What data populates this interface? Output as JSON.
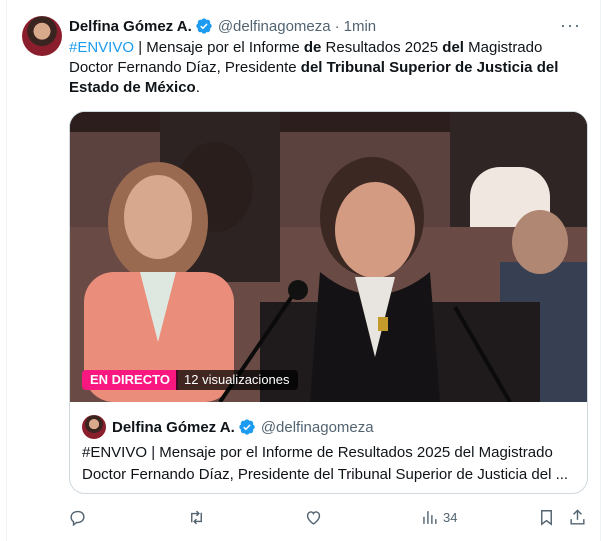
{
  "tweet": {
    "author_name": "Delfina Gómez A.",
    "handle": "@delfinagomeza",
    "separator": "·",
    "time": "1min",
    "more": "···",
    "text_segments": [
      {
        "text": "#ENVIVO",
        "style": "hashtag"
      },
      {
        "text": " | Mensaje por el Informe ",
        "style": "normal"
      },
      {
        "text": "de",
        "style": "bold"
      },
      {
        "text": " Resultados 2025 ",
        "style": "normal"
      },
      {
        "text": "del",
        "style": "bold"
      },
      {
        "text": " Magistrado Doctor Fernando Díaz, Presidente ",
        "style": "normal"
      },
      {
        "text": "del Tribunal Superior de Justicia del Estado de México",
        "style": "bold"
      },
      {
        "text": ".",
        "style": "normal"
      }
    ]
  },
  "video": {
    "live_label": "EN DIRECTO",
    "views_label": "12 visualizaciones"
  },
  "quote": {
    "author_name": "Delfina Gómez A.",
    "handle": "@delfinagomeza",
    "hashtag": "#ENVIVO",
    "line1_rest": " | Mensaje por el Informe de Resultados 2025 del Magistrado",
    "line2": "Doctor Fernando Díaz, Presidente del Tribunal Superior de Justicia del ..."
  },
  "actions": {
    "reply": "reply-icon",
    "retweet": "retweet-icon",
    "like": "heart-icon",
    "views_count": "34",
    "bookmark": "bookmark-icon",
    "share": "share-icon"
  },
  "colors": {
    "accent": "#1d9bf0",
    "live": "#f91880",
    "muted": "#536471",
    "border": "#cfd9de"
  }
}
